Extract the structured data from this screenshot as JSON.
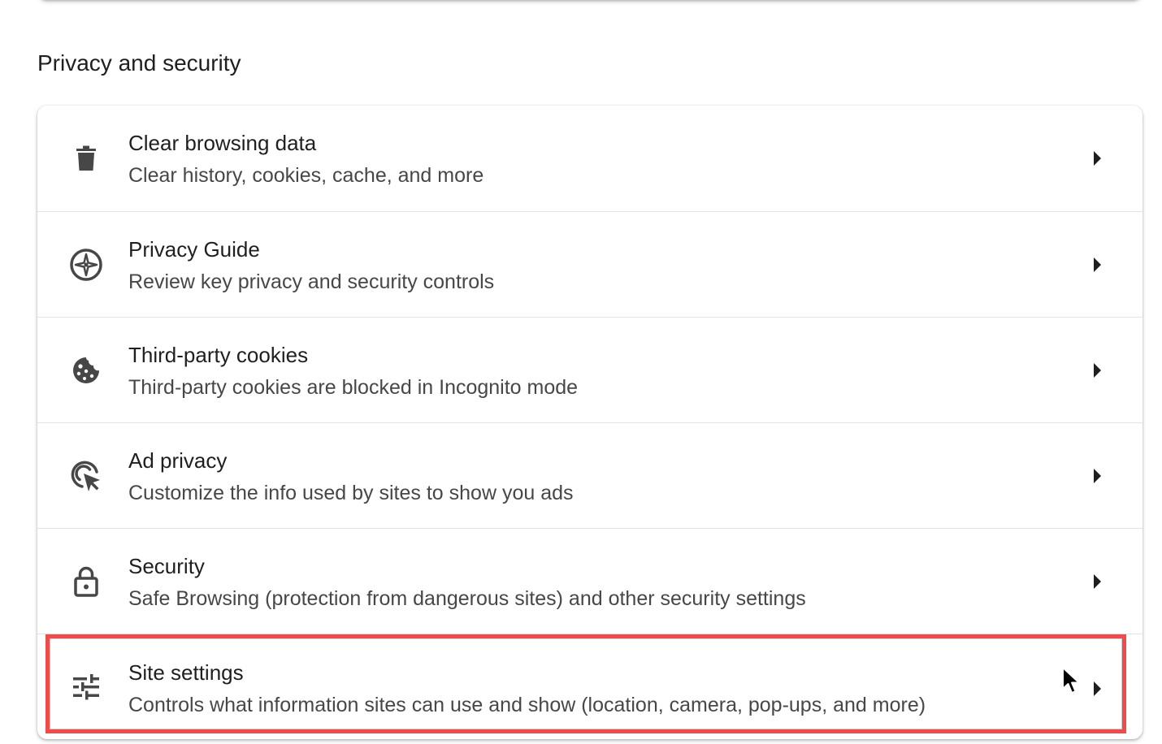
{
  "section": {
    "title": "Privacy and security"
  },
  "rows": [
    {
      "title": "Clear browsing data",
      "subtitle": "Clear history, cookies, cache, and more",
      "icon": "trash-icon"
    },
    {
      "title": "Privacy Guide",
      "subtitle": "Review key privacy and security controls",
      "icon": "compass-icon"
    },
    {
      "title": "Third-party cookies",
      "subtitle": "Third-party cookies are blocked in Incognito mode",
      "icon": "cookie-icon"
    },
    {
      "title": "Ad privacy",
      "subtitle": "Customize the info used by sites to show you ads",
      "icon": "ad-privacy-icon"
    },
    {
      "title": "Security",
      "subtitle": "Safe Browsing (protection from dangerous sites) and other security settings",
      "icon": "lock-icon"
    },
    {
      "title": "Site settings",
      "subtitle": "Controls what information sites can use and show (location, camera, pop-ups, and more)",
      "icon": "sliders-icon"
    }
  ],
  "colors": {
    "highlight": "#ef4b4b",
    "icon": "#474747",
    "text_primary": "#1f1f1f",
    "text_secondary": "#474747"
  }
}
